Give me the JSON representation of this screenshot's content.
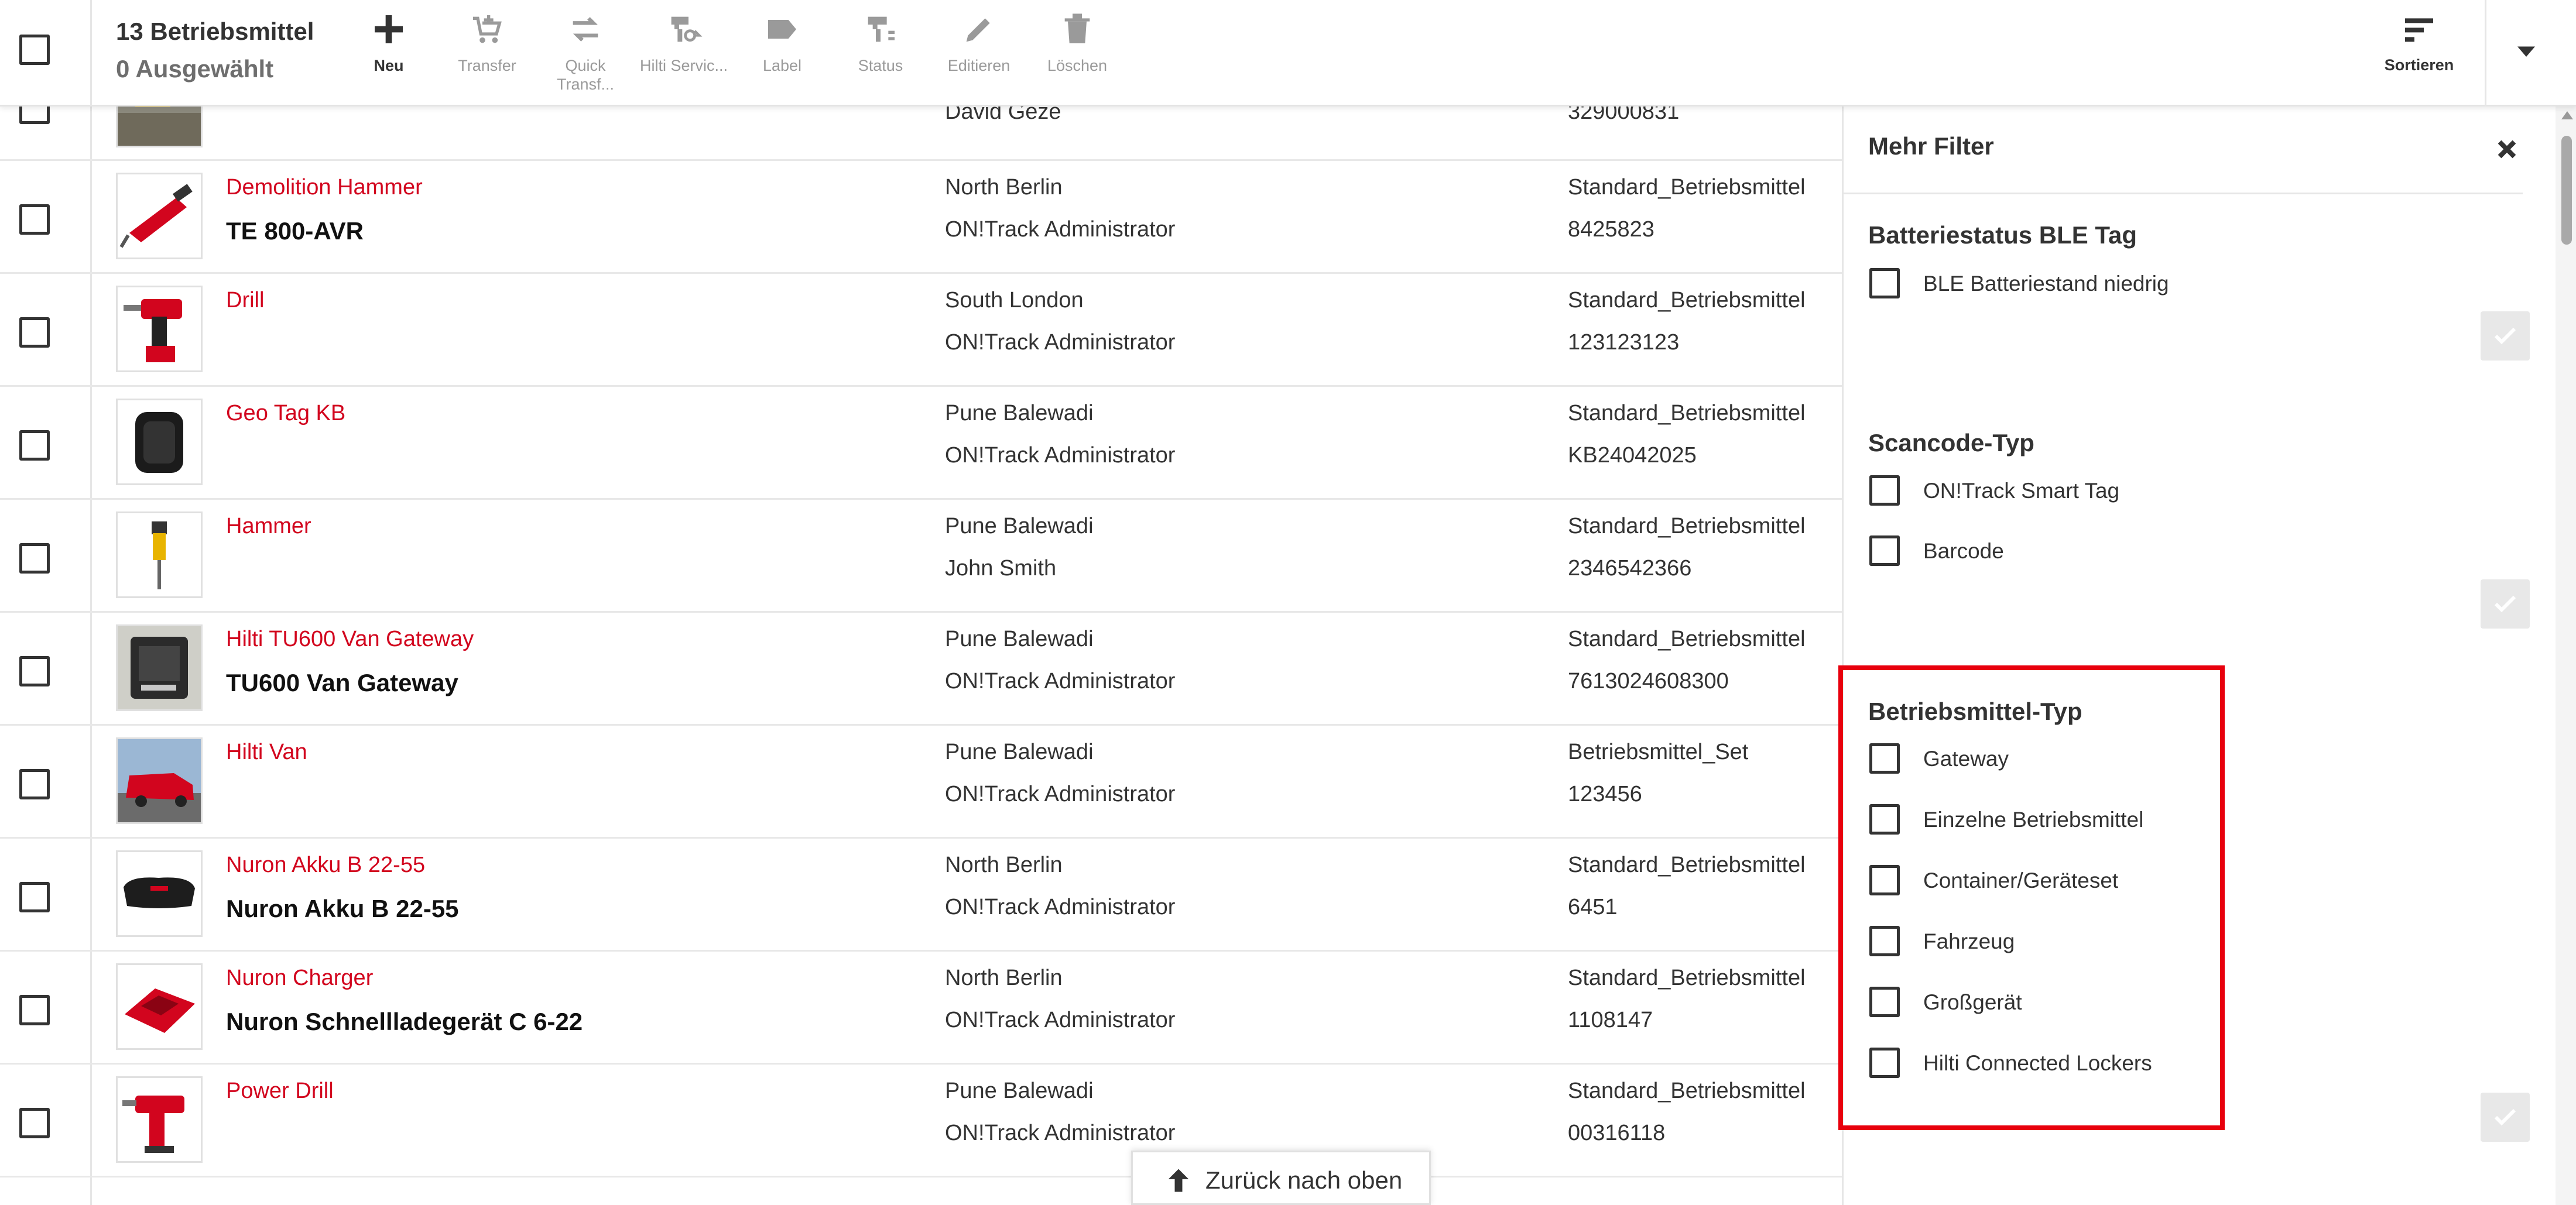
{
  "toolbar": {
    "count_label": "13 Betriebsmittel",
    "selected_label": "0 Ausgewählt",
    "buttons": {
      "new": "Neu",
      "transfer": "Transfer",
      "quick_transfer": "Quick Transf...",
      "hilti_service": "Hilti Servic...",
      "label": "Label",
      "status": "Status",
      "edit": "Editieren",
      "delete": "Löschen"
    },
    "sort_label": "Sortieren"
  },
  "rows": [
    {
      "name": "",
      "title": "",
      "location": "",
      "responsible": "David Geze",
      "template": "",
      "number": "329000831"
    },
    {
      "name": "Demolition Hammer",
      "title": "TE 800-AVR",
      "location": "North Berlin",
      "responsible": "ON!Track Administrator",
      "template": "Standard_Betriebsmittel",
      "number": "8425823"
    },
    {
      "name": "Drill",
      "title": "",
      "location": "South London",
      "responsible": "ON!Track Administrator",
      "template": "Standard_Betriebsmittel",
      "number": "123123123"
    },
    {
      "name": "Geo Tag KB",
      "title": "",
      "location": "Pune Balewadi",
      "responsible": "ON!Track Administrator",
      "template": "Standard_Betriebsmittel",
      "number": "KB24042025"
    },
    {
      "name": "Hammer",
      "title": "",
      "location": "Pune Balewadi",
      "responsible": "John Smith",
      "template": "Standard_Betriebsmittel",
      "number": "2346542366"
    },
    {
      "name": "Hilti TU600 Van Gateway",
      "title": "TU600 Van Gateway",
      "location": "Pune Balewadi",
      "responsible": "ON!Track Administrator",
      "template": "Standard_Betriebsmittel",
      "number": "7613024608300"
    },
    {
      "name": "Hilti Van",
      "title": "",
      "location": "Pune Balewadi",
      "responsible": "ON!Track Administrator",
      "template": "Betriebsmittel_Set",
      "number": "123456"
    },
    {
      "name": "Nuron Akku B 22-55",
      "title": "Nuron Akku B 22-55",
      "location": "North Berlin",
      "responsible": "ON!Track Administrator",
      "template": "Standard_Betriebsmittel",
      "number": "6451"
    },
    {
      "name": "Nuron Charger",
      "title": "Nuron Schnellladegerät C 6-22",
      "location": "North Berlin",
      "responsible": "ON!Track Administrator",
      "template": "Standard_Betriebsmittel",
      "number": "1108147"
    },
    {
      "name": "Power Drill",
      "title": "",
      "location": "Pune Balewadi",
      "responsible": "ON!Track Administrator",
      "template": "Standard_Betriebsmittel",
      "number": "00316118"
    }
  ],
  "back_to_top": "Zurück nach oben",
  "filter_panel": {
    "title": "Mehr Filter",
    "groups": [
      {
        "title": "Batteriestatus BLE Tag",
        "options": [
          "BLE Batteriestand niedrig"
        ]
      },
      {
        "title": "Scancode-Typ",
        "options": [
          "ON!Track Smart Tag",
          "Barcode"
        ]
      },
      {
        "title": "Betriebsmittel-Typ",
        "options": [
          "Gateway",
          "Einzelne Betriebsmittel",
          "Container/Geräteset",
          "Fahrzeug",
          "Großgerät",
          "Hilti Connected Lockers"
        ]
      }
    ]
  },
  "colors": {
    "accent_red": "#d2051e",
    "highlight_red": "#e8000d"
  }
}
